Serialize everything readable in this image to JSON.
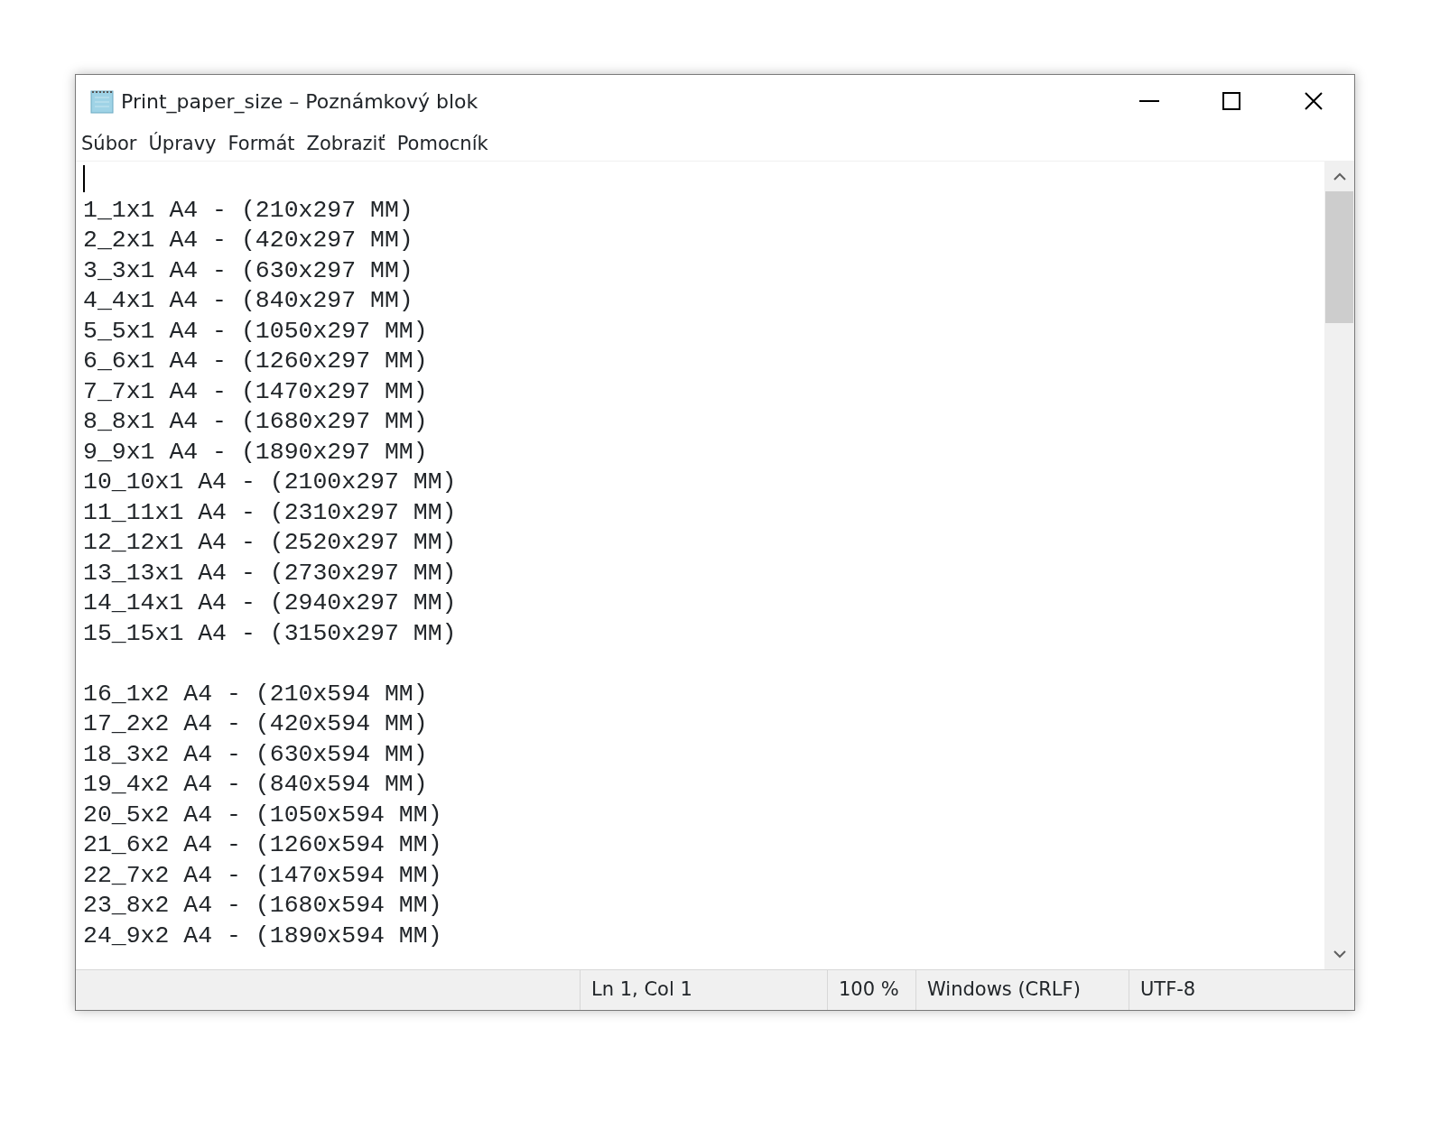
{
  "window": {
    "title": "Print_paper_size – Poznámkový blok"
  },
  "menu": [
    {
      "label": "Súbor"
    },
    {
      "label": "Úpravy"
    },
    {
      "label": "Formát"
    },
    {
      "label": "Zobraziť"
    },
    {
      "label": "Pomocník"
    }
  ],
  "editor": {
    "blocks": [
      [
        "1_1x1 A4 - (210x297 MM)",
        "2_2x1 A4 - (420x297 MM)",
        "3_3x1 A4 - (630x297 MM)",
        "4_4x1 A4 - (840x297 MM)",
        "5_5x1 A4 - (1050x297 MM)",
        "6_6x1 A4 - (1260x297 MM)",
        "7_7x1 A4 - (1470x297 MM)",
        "8_8x1 A4 - (1680x297 MM)",
        "9_9x1 A4 - (1890x297 MM)",
        "10_10x1 A4 - (2100x297 MM)",
        "11_11x1 A4 - (2310x297 MM)",
        "12_12x1 A4 - (2520x297 MM)",
        "13_13x1 A4 - (2730x297 MM)",
        "14_14x1 A4 - (2940x297 MM)",
        "15_15x1 A4 - (3150x297 MM)"
      ],
      [
        "16_1x2 A4 - (210x594 MM)",
        "17_2x2 A4 - (420x594 MM)",
        "18_3x2 A4 - (630x594 MM)",
        "19_4x2 A4 - (840x594 MM)",
        "20_5x2 A4 - (1050x594 MM)",
        "21_6x2 A4 - (1260x594 MM)",
        "22_7x2 A4 - (1470x594 MM)",
        "23_8x2 A4 - (1680x594 MM)",
        "24_9x2 A4 - (1890x594 MM)"
      ]
    ]
  },
  "status_bar": {
    "position": "Ln 1, Col 1",
    "zoom": "100 %",
    "line_endings": "Windows (CRLF)",
    "encoding": "UTF-8"
  }
}
